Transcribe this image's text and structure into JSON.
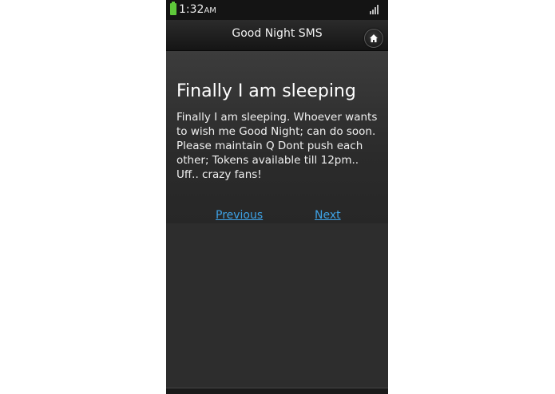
{
  "status_bar": {
    "time": "1:32",
    "ampm": "AM"
  },
  "app": {
    "title": "Good Night SMS"
  },
  "message": {
    "heading": "Finally I am sleeping",
    "body": "Finally I am sleeping. Whoever wants to wish me Good Night; can do soon. Please maintain Q Dont push each other; Tokens available till 12pm.. Uff.. crazy fans!"
  },
  "nav": {
    "previous_label": "Previous",
    "next_label": "Next"
  },
  "colors": {
    "link": "#3ea2e6",
    "battery": "#5ec83a",
    "background": "#2a2a2a"
  },
  "icons": {
    "home": "home-icon",
    "battery": "battery-icon",
    "signal": "signal-icon"
  }
}
